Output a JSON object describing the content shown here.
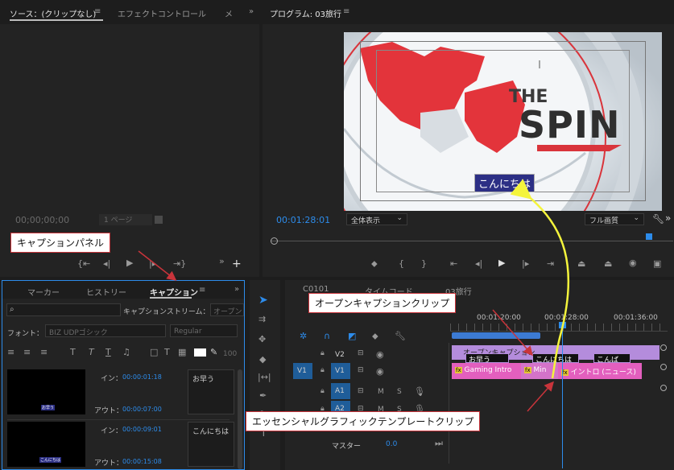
{
  "source_panel": {
    "title": "ソース：(クリップなし)",
    "menu": "≡",
    "tab2": "エフェクトコントロール",
    "tab2_close": "メ",
    "more": "»",
    "timecode": "00;00;00;00",
    "page": "1 ページ"
  },
  "program_panel": {
    "title": "プログラム: 03旅行",
    "menu": "≡",
    "timecode": "00:01:28:01",
    "zoom_select": "全体表示",
    "quality_select": "フル画質",
    "video_title_the": "THE",
    "video_title_spin": "SPIN",
    "caption_text": "こんにちは"
  },
  "caption_panel": {
    "tabs": [
      "マーカー",
      "ヒストリー",
      "キャプション"
    ],
    "menu": "≡",
    "stream_label": "キャプションストリーム：",
    "stream_value": "オープン",
    "font_label": "フォント：",
    "font_value": "BIZ UDPゴシック",
    "style_value": "Regular",
    "size_value": "100",
    "items": [
      {
        "in_label": "イン：",
        "in": "00:00:01:18",
        "out_label": "アウト：",
        "out": "00:00:07:00",
        "text": "お早う",
        "thumb_text": "お早う"
      },
      {
        "in_label": "イン：",
        "in": "00:00:09:01",
        "out_label": "アウト：",
        "out": "00:00:15:08",
        "text": "こんにちは",
        "thumb_text": "こんにちは"
      }
    ]
  },
  "timeline": {
    "tab1": "C0101",
    "tab2": "タイムコード",
    "tab3": "03旅行",
    "ruler": [
      "00:01:20:00",
      "00:01:28:00",
      "00:01:36:00"
    ],
    "tracks": [
      {
        "id": "V2"
      },
      {
        "id": "V1",
        "source": "V1"
      },
      {
        "id": "A1"
      },
      {
        "id": "A2"
      }
    ],
    "master_label": "マスター",
    "master_value": "0.0",
    "caption_track_label": "オープンキャプション",
    "caption_clips": [
      "お早う",
      "こんにちは",
      "こんば"
    ],
    "gfx_clips": [
      "Gaming Intro",
      "Min",
      "イントロ (ニュース)"
    ],
    "m": "M",
    "s": "S"
  },
  "callouts": {
    "caption_panel": "キャプションパネル",
    "open_caption_clip": "オープンキャプションクリップ",
    "essential_graphics_clip": "エッセンシャルグラフィックテンプレートクリップ"
  },
  "colors": {
    "accent_blue": "#2d8ceb",
    "callout_border": "#c9343b",
    "arrow_yellow": "#f4f43c",
    "gfx_pink": "#e35fbe",
    "caption_purple": "#b48cdc"
  }
}
